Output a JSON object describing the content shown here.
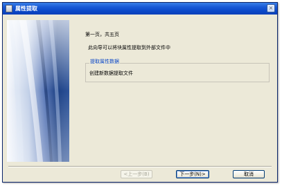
{
  "window": {
    "title": "属性提取",
    "close_glyph": "×"
  },
  "wizard": {
    "heading": "第一页，共五页",
    "description": "此向导可以将块属性提取到外部文件中",
    "group_label": "提取属性数据",
    "group_content": "创建新数据提取文件"
  },
  "buttons": {
    "back": "<上一步(B)",
    "next": "下一步(N)>",
    "cancel": "取消"
  },
  "colors": {
    "titlebar": "#0a48c8",
    "dialog_bg": "#ece9d8",
    "group_label": "#0a47c8",
    "side_image_dark": "#1b3f83"
  },
  "icons": {
    "app": "app-icon",
    "close": "close-icon"
  }
}
